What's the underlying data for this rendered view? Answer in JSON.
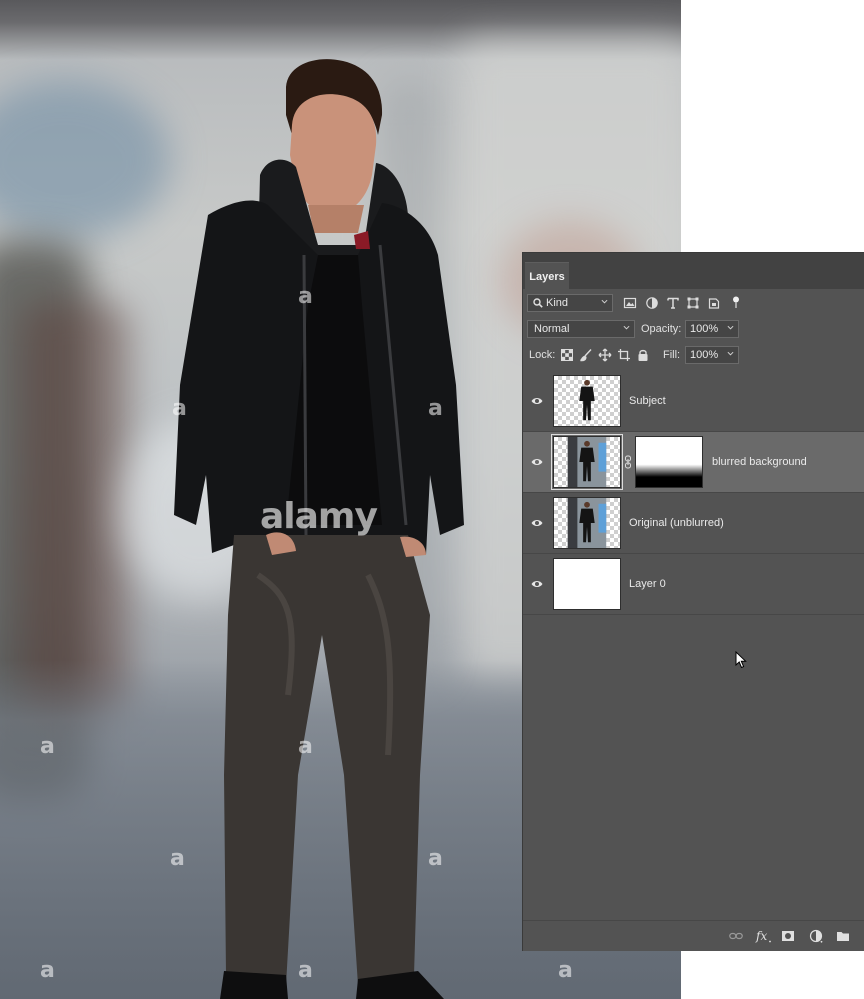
{
  "watermark": {
    "brand": "alamy",
    "glyph": "a"
  },
  "panel": {
    "tab_label": "Layers",
    "filter": {
      "label": "Kind",
      "icon": "search-icon"
    },
    "filter_icons": [
      "image-filter-icon",
      "adjustment-filter-icon",
      "type-filter-icon",
      "shape-filter-icon",
      "smart-object-filter-icon",
      "filter-toggle-icon"
    ],
    "blend_mode": "Normal",
    "opacity_label": "Opacity:",
    "opacity_value": "100%",
    "lock_label": "Lock:",
    "lock_icons": [
      "lock-transparent-icon",
      "lock-image-icon",
      "lock-position-icon",
      "lock-artboard-icon",
      "lock-all-icon"
    ],
    "fill_label": "Fill:",
    "fill_value": "100%",
    "layers": [
      {
        "name": "Subject",
        "visible": true,
        "selected": false
      },
      {
        "name": "blurred background",
        "visible": true,
        "selected": true,
        "has_mask": true
      },
      {
        "name": "Original (unblurred)",
        "visible": true,
        "selected": false
      },
      {
        "name": "Layer 0",
        "visible": true,
        "selected": false
      }
    ],
    "footer_icons": [
      "link-layers-icon",
      "fx-icon",
      "add-mask-icon",
      "new-adjustment-icon",
      "new-group-icon"
    ]
  },
  "colors": {
    "panel_bg": "#535353",
    "panel_dark": "#424242",
    "selected_row": "#6a6a6a"
  }
}
